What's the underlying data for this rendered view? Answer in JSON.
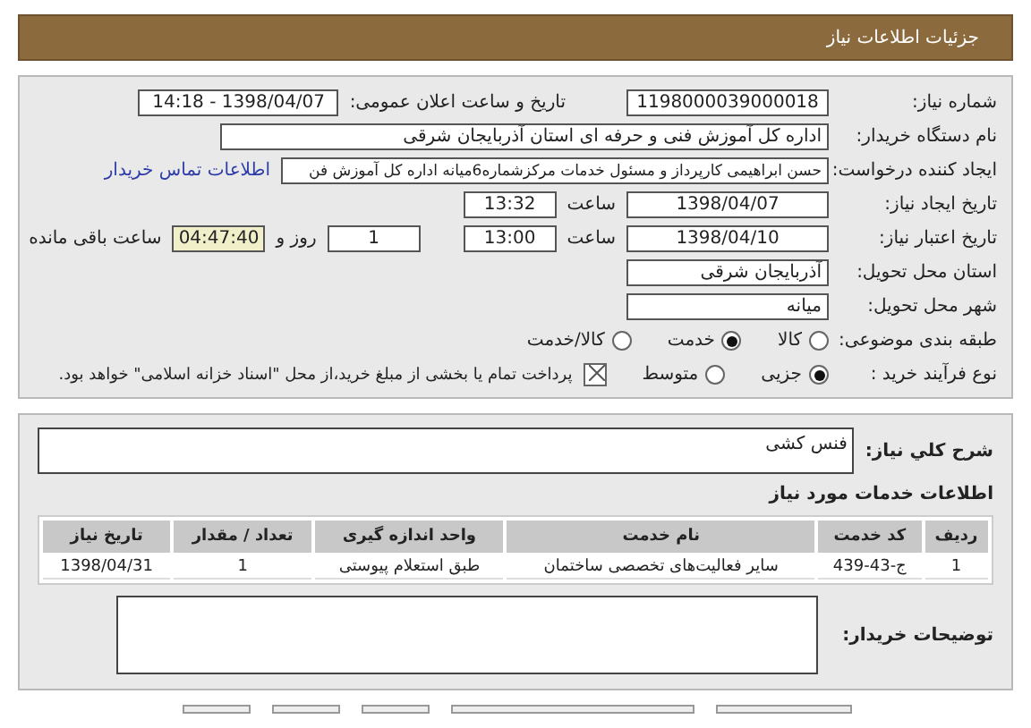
{
  "header": {
    "title": "جزئیات اطلاعات نیاز"
  },
  "details": {
    "need_number": {
      "label": "شماره نیاز:",
      "value": "1198000039000018"
    },
    "announce": {
      "label": "تاریخ و ساعت اعلان عمومی:",
      "value": "1398/04/07 - 14:18"
    },
    "buyer": {
      "label": "نام دستگاه خریدار:",
      "value": "اداره کل آموزش فنی و حرفه ای استان آذربایجان شرقی"
    },
    "requester": {
      "label": "ایجاد کننده درخواست:",
      "value": "حسن ابراهیمی کارپرداز و مسئول خدمات مرکزشماره6میانه اداره کل آموزش فن",
      "link": "اطلاعات تماس خریدار"
    },
    "created": {
      "label": "تاریخ ایجاد نیاز:",
      "date": "1398/04/07",
      "time_label": "ساعت",
      "time": "13:32"
    },
    "deadline": {
      "label": "تاریخ اعتبار نیاز:",
      "date": "1398/04/10",
      "time_label": "ساعت",
      "time": "13:00",
      "days": "1",
      "days_label": "روز و",
      "remaining": "04:47:40",
      "remaining_label": "ساعت باقی مانده"
    },
    "province": {
      "label": "استان محل تحویل:",
      "value": "آذربایجان شرقی"
    },
    "city": {
      "label": "شهر محل تحویل:",
      "value": "میانه"
    },
    "category": {
      "label": "طبقه بندی موضوعی:",
      "options": [
        {
          "label": "کالا",
          "selected": false
        },
        {
          "label": "خدمت",
          "selected": true
        },
        {
          "label": "کالا/خدمت",
          "selected": false
        }
      ]
    },
    "process": {
      "label": "نوع فرآیند خرید :",
      "options": [
        {
          "label": "جزیی",
          "selected": true
        },
        {
          "label": "متوسط",
          "selected": false
        }
      ],
      "treasury": {
        "checked": true,
        "label": "پرداخت تمام یا بخشی از مبلغ خرید،از محل \"اسناد خزانه اسلامی\" خواهد بود."
      }
    }
  },
  "description": {
    "label": "شرح کلي نياز:",
    "value": "فنس کشی"
  },
  "services": {
    "title": "اطلاعات خدمات مورد نیاز",
    "columns": [
      "ردیف",
      "کد خدمت",
      "نام خدمت",
      "واحد اندازه گیری",
      "تعداد / مقدار",
      "تاریخ نیاز"
    ],
    "rows": [
      [
        "1",
        "ج-43-439",
        "سایر فعالیت‌های تخصصی ساختمان",
        "طبق استعلام پیوستی",
        "1",
        "1398/04/31"
      ]
    ]
  },
  "notes": {
    "label": "توضیحات خریدار:"
  }
}
